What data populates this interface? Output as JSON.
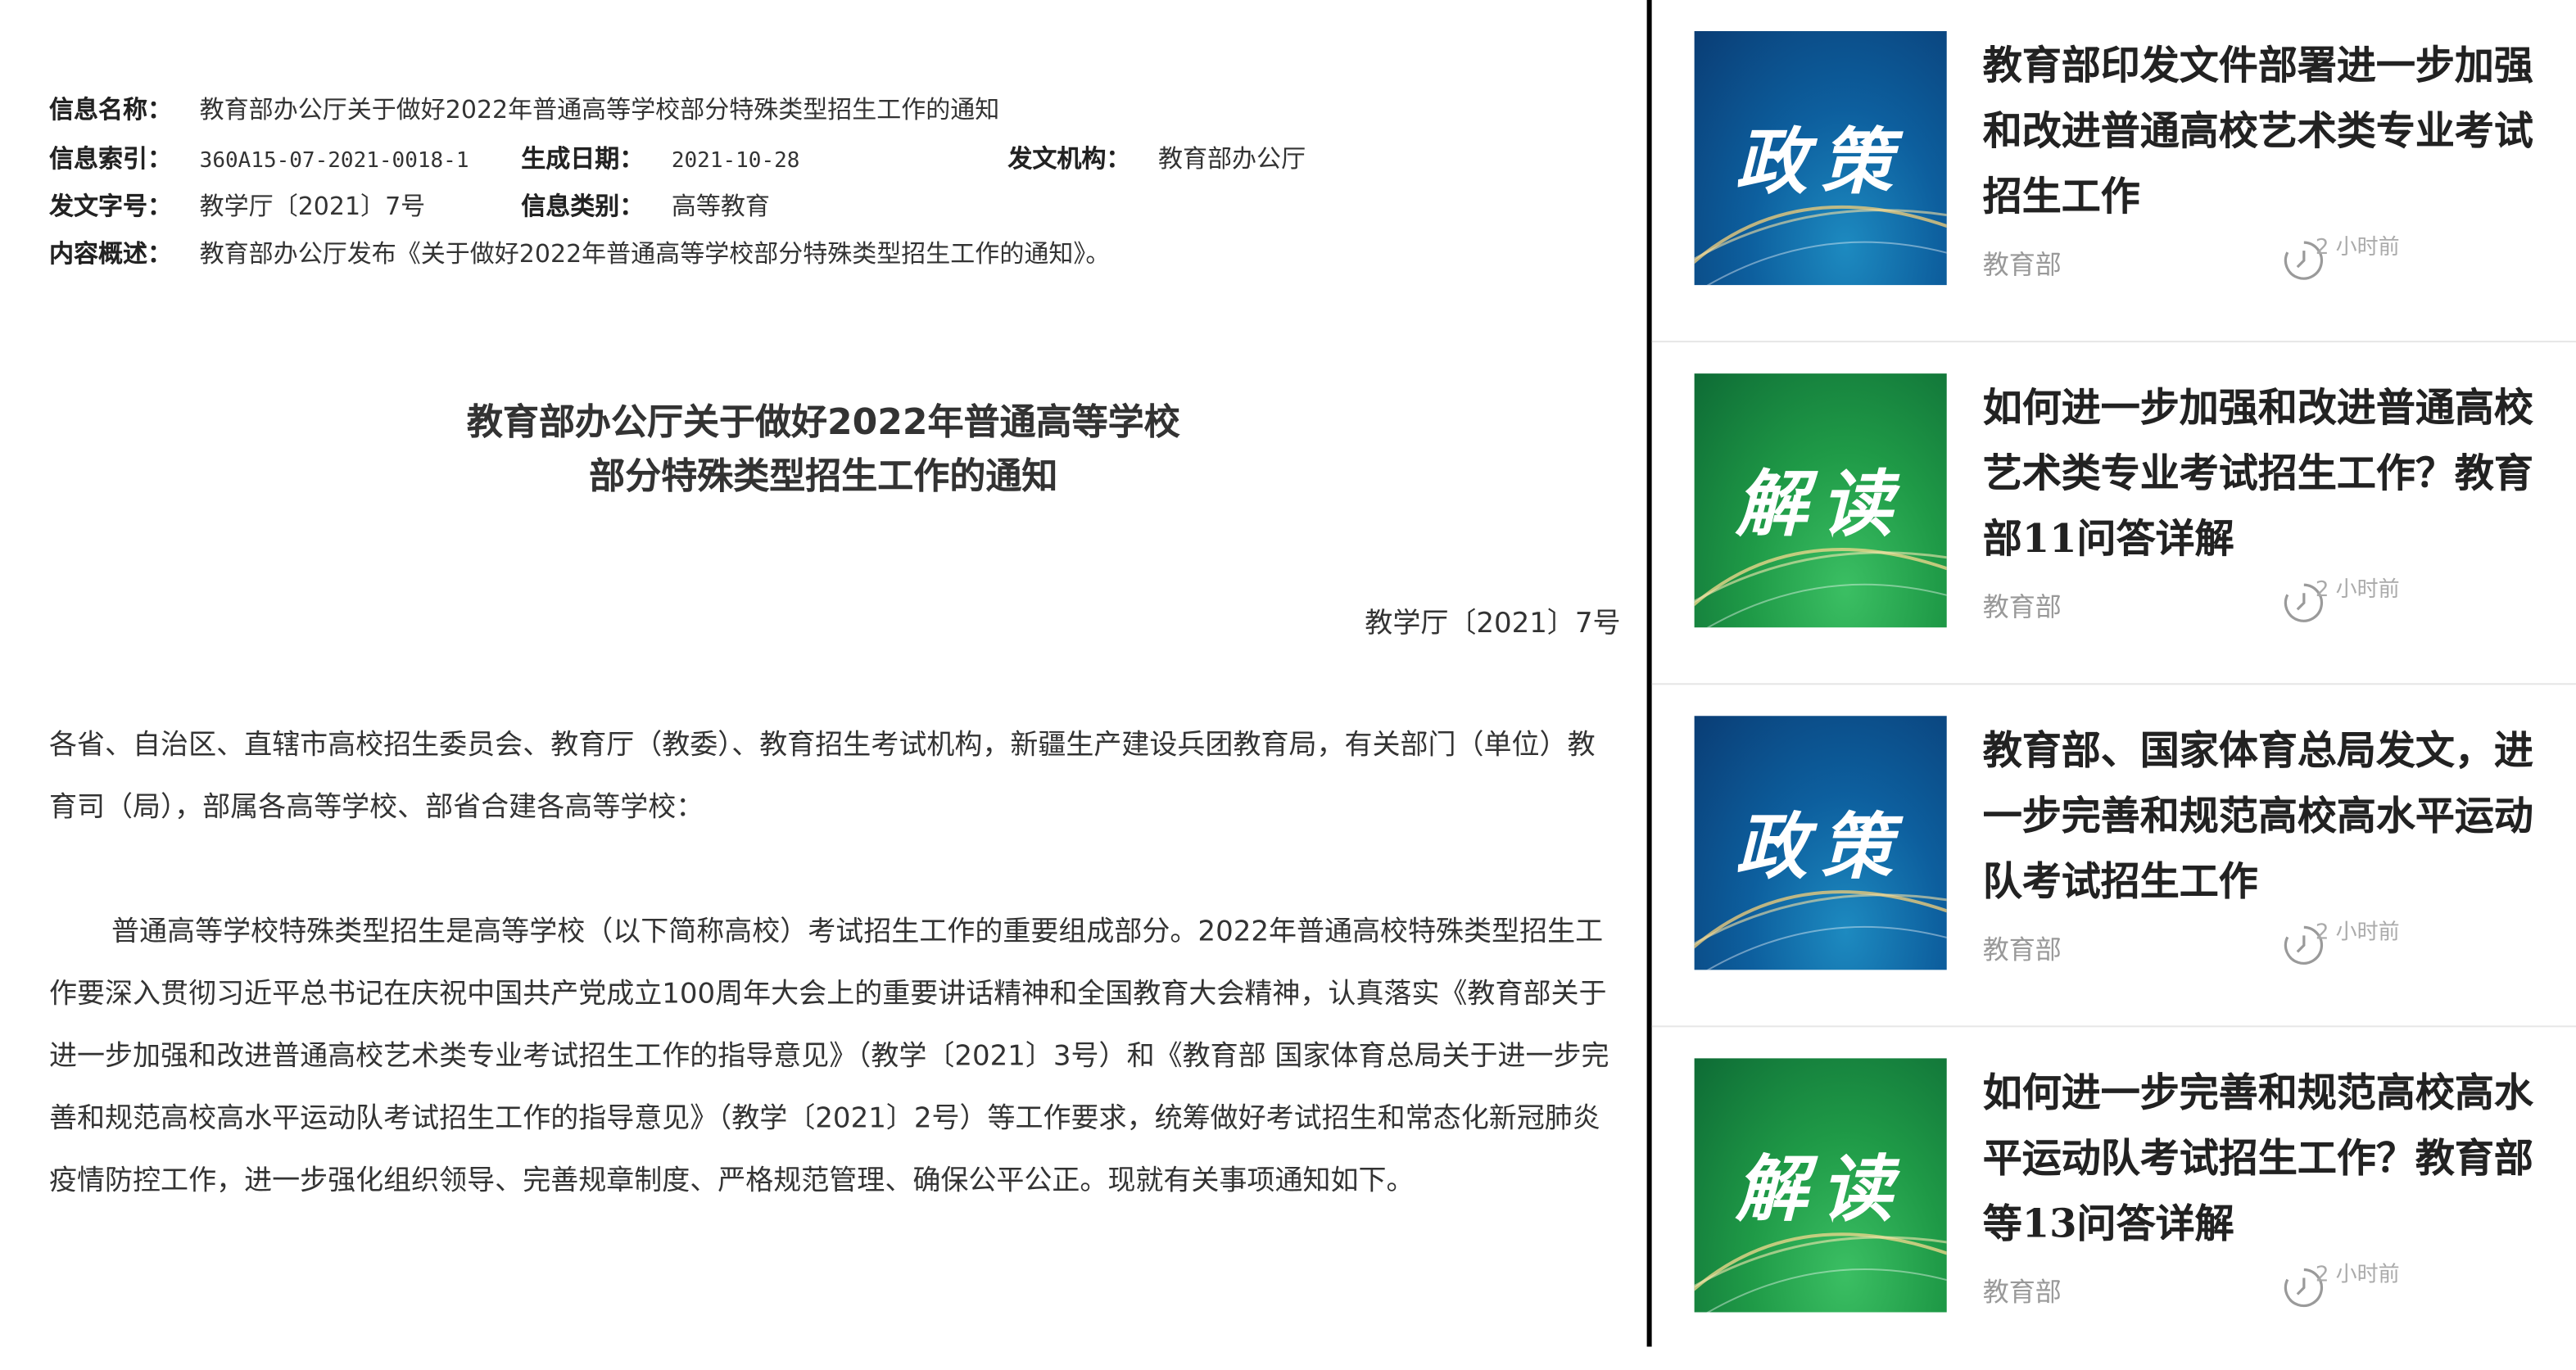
{
  "meta": {
    "info_name_label": "信息名称：",
    "info_name": "教育部办公厅关于做好2022年普通高等学校部分特殊类型招生工作的通知",
    "index_label": "信息索引：",
    "index": "360A15-07-2021-0018-1",
    "date_label": "生成日期：",
    "date": "2021-10-28",
    "issuer_label": "发文机构：",
    "issuer": "教育部办公厅",
    "doc_no_label": "发文字号：",
    "doc_no": "教学厅〔2021〕7号",
    "category_label": "信息类别：",
    "category": "高等教育",
    "summary_label": "内容概述：",
    "summary": "教育部办公厅发布《关于做好2022年普通高等学校部分特殊类型招生工作的通知》。"
  },
  "document": {
    "title_line1": "教育部办公厅关于做好2022年普通高等学校",
    "title_line2": "部分特殊类型招生工作的通知",
    "number": "教学厅〔2021〕7号",
    "salutation": "各省、自治区、直辖市高校招生委员会、教育厅（教委）、教育招生考试机构，新疆生产建设兵团教育局，有关部门（单位）教育司（局），部属各高等学校、部省合建各高等学校：",
    "body": "普通高等学校特殊类型招生是高等学校（以下简称高校）考试招生工作的重要组成部分。2022年普通高校特殊类型招生工作要深入贯彻习近平总书记在庆祝中国共产党成立100周年大会上的重要讲话精神和全国教育大会精神，认真落实《教育部关于进一步加强和改进普通高校艺术类专业考试招生工作的指导意见》（教学〔2021〕3号）和《教育部 国家体育总局关于进一步完善和规范高校高水平运动队考试招生工作的指导意见》（教学〔2021〕2号）等工作要求，统筹做好考试招生和常态化新冠肺炎疫情防控工作，进一步强化组织领导、完善规章制度、严格规范管理、确保公平公正。现就有关事项通知如下。"
  },
  "news": [
    {
      "thumb_label": "政策",
      "thumb_color": "#0d5f9e",
      "title": "教育部印发文件部署进一步加强和改进普通高校艺术类专业考试招生工作",
      "source": "教育部",
      "time": "2 小时前"
    },
    {
      "thumb_label": "解读",
      "thumb_color": "#1f9a47",
      "title": "如何进一步加强和改进普通高校艺术类专业考试招生工作？教育部11问答详解",
      "source": "教育部",
      "time": "2 小时前"
    },
    {
      "thumb_label": "政策",
      "thumb_color": "#0d5f9e",
      "title": "教育部、国家体育总局发文，进一步完善和规范高校高水平运动队考试招生工作",
      "source": "教育部",
      "time": "2 小时前"
    },
    {
      "thumb_label": "解读",
      "thumb_color": "#1f9a47",
      "title": "如何进一步完善和规范高校高水平运动队考试招生工作？教育部等13问答详解",
      "source": "教育部",
      "time": "2 小时前"
    }
  ]
}
